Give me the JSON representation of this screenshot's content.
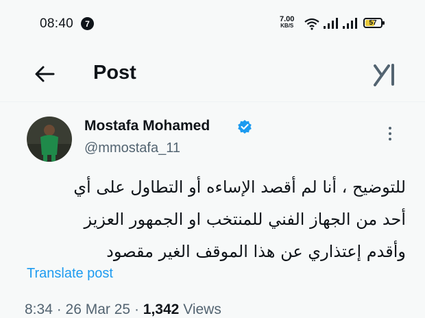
{
  "status_bar": {
    "time": "08:40",
    "notification_count": "7",
    "net_speed": "7.00",
    "net_unit": "KB/S",
    "battery": "57",
    "battery_level": 0.57
  },
  "header": {
    "title": "Post"
  },
  "post": {
    "author_name": "Mostafa Mohamed",
    "handle": "@mmostafa_11",
    "verified": true,
    "text_lines": [
      "للتوضيح ، أنا لم أقصد الإساءه أو التطاول على أي",
      "أحد من الجهاز الفني للمنتخب او الجمهور العزيز",
      "وأقدم إعتذاري عن هذا الموقف الغير مقصود"
    ],
    "translate_label": "Translate post",
    "time": "8:34",
    "date": "26 Mar 25",
    "views_count": "1,342",
    "views_label": "Views"
  },
  "colors": {
    "accent": "#1d9bf0",
    "text": "#0f1419",
    "secondary": "#536471",
    "background": "#f7f9f9"
  },
  "icons": {
    "back": "arrow-left-icon",
    "grok": "grok-icon",
    "verified": "verified-badge-icon",
    "more": "more-vertical-icon"
  }
}
